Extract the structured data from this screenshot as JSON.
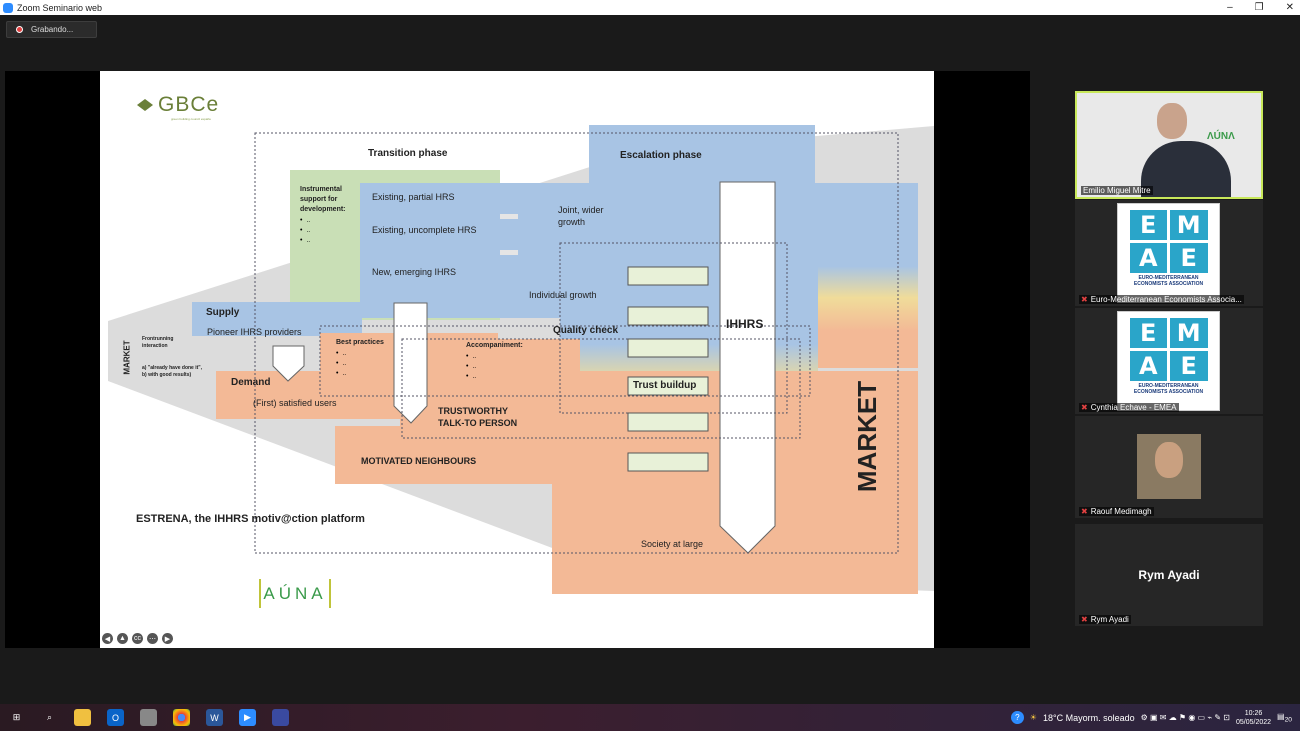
{
  "window": {
    "title": "Zoom Seminario web",
    "controls": [
      "–",
      "❐",
      "✕"
    ]
  },
  "recording": {
    "label": "Grabando..."
  },
  "slide": {
    "logo": {
      "name": "GBCe",
      "sub": "green building council españa"
    },
    "transition_phase": "Transition phase",
    "escalation_phase": "Escalation phase",
    "instrumental": {
      "title": "Instrumental support for development:",
      "bullets": [
        "..",
        "..",
        ".."
      ]
    },
    "hrs": {
      "partial": "Existing, partial HRS",
      "uncomplete": "Existing, uncomplete HRS",
      "emerging": "New, emerging IHRS"
    },
    "joint": "Joint, wider growth",
    "individual": "Individual growth",
    "quality": "Quality check",
    "ihhrs": "IHHRS",
    "market_big": "MARKET",
    "market_small": "MARKET",
    "supply": "Supply",
    "pioneer": "Pioneer IHRS providers",
    "frontrunning": {
      "title": "Frontrunning interaction",
      "a": "a) \"already have done it\",",
      "b": "b) with good results)"
    },
    "best_practices": {
      "title": "Best practices",
      "bullets": [
        "..",
        "..",
        ".."
      ]
    },
    "accompaniment": {
      "title": "Accompaniment:",
      "bullets": [
        "..",
        "..",
        ".."
      ]
    },
    "demand": "Demand",
    "satisfied": "(First) satisfied users",
    "trustworthy": "TRUSTWORTHY TALK-TO PERSON",
    "trust_buildup": "Trust buildup",
    "motivated": "MOTIVATED NEIGHBOURS",
    "estrena": "ESTRENA, the IHHRS motiv@ction platform",
    "society": "Society at large",
    "auna": "AÚNA"
  },
  "participants": [
    {
      "name": "Emilio Miguel Mitre",
      "type": "video"
    },
    {
      "name": "Euro-Mediterranean Economists Associa...",
      "type": "logo",
      "logo_text": "EURO-MEDITERRANEAN ECONOMISTS ASSOCIATION"
    },
    {
      "name": "Cynthia Echave - EMEA",
      "type": "logo",
      "logo_text": "EURO-MEDITERRANEAN ECONOMISTS ASSOCIATION"
    },
    {
      "name": "Raouf Medimagh",
      "type": "photo"
    },
    {
      "name": "Rym Ayadi",
      "type": "name-only"
    }
  ],
  "taskbar": {
    "weather": "18°C  Mayorm. soleado",
    "time": "10:26",
    "date": "05/05/2022",
    "notifications": "20",
    "lang_icon": "windows-start-icon"
  },
  "colors": {
    "blue": "#a8c4e4",
    "green": "#c9dfb6",
    "peach": "#f3b996",
    "brand": "#6a7f38"
  }
}
